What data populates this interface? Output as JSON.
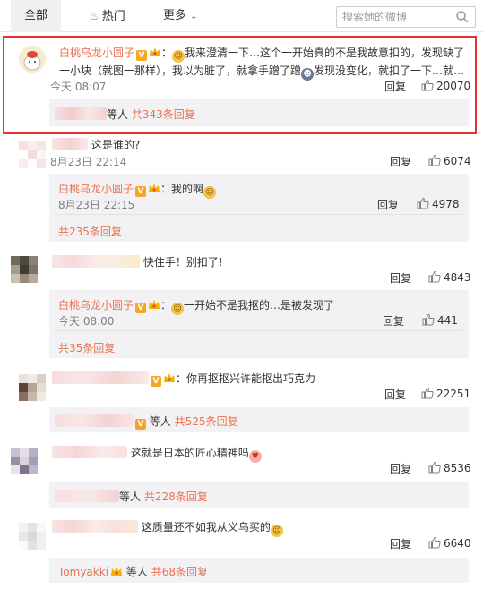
{
  "tabs": {
    "all": "全部",
    "hot": "热门",
    "more": "更多"
  },
  "search": {
    "placeholder": "搜索她的微博"
  },
  "colors": {
    "accent": "#eb7350",
    "highlight_border": "#e63131"
  },
  "post": {
    "author": "白桃乌龙小圆子",
    "text_line1": "我来澄清一下…这个一开始真的不是我故意扣的，发现缺了",
    "text_line2a": "一小块（就图一那样），我以为脏了，就拿手蹭了蹭",
    "text_line2b": "发现没变化，就扣了一下…就…",
    "time": "今天 08:07",
    "reply_label": "回复",
    "likes": "20070",
    "reply_people_suffix": "等人",
    "reply_count": "共343条回复"
  },
  "comments": [
    {
      "text": "这是谁的?",
      "time": "8月23日 22:14",
      "reply_label": "回复",
      "likes": "6074",
      "sub": {
        "author": "白桃乌龙小圆子",
        "text": "我的啊",
        "time": "8月23日 22:15",
        "reply_label": "回复",
        "likes": "4978"
      },
      "reply_count": "共235条回复"
    },
    {
      "text": "快住手！别扣了!",
      "reply_label": "回复",
      "likes": "4843",
      "sub": {
        "author": "白桃乌龙小圆子",
        "text": "一开始不是我抠的…是被发现了",
        "time": "今天 08:00",
        "reply_label": "回复",
        "likes": "441"
      },
      "reply_count": "共35条回复"
    },
    {
      "text": "你再抠抠兴许能抠出巧克力",
      "reply_label": "回复",
      "likes": "22251",
      "reply_people_suffix": "等人",
      "reply_count": "共525条回复"
    },
    {
      "text": "这就是日本的匠心精神吗",
      "reply_label": "回复",
      "likes": "8536",
      "reply_people_suffix": "等人",
      "reply_count": "共228条回复"
    },
    {
      "text": "这质量还不如我从义乌买的",
      "reply_label": "回复",
      "likes": "6640",
      "reply_people": "Tomyakki",
      "reply_people_suffix": "等人",
      "reply_count": "共68条回复"
    }
  ]
}
